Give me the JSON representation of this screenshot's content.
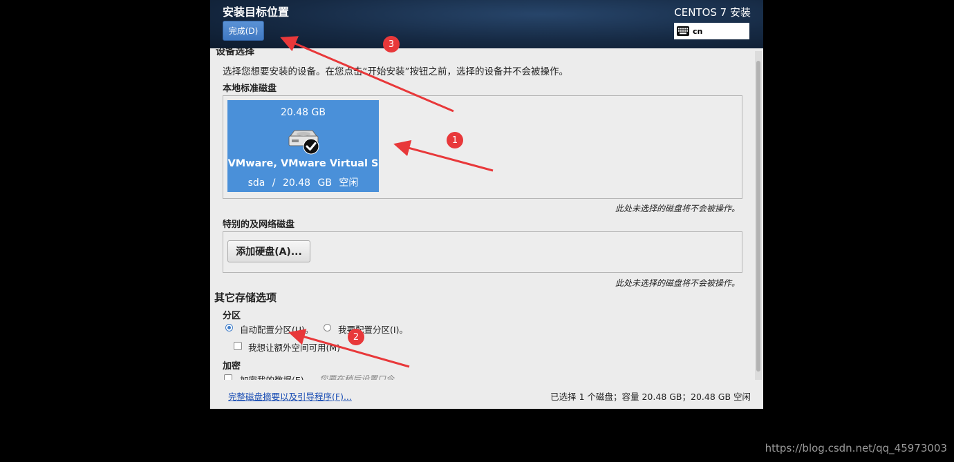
{
  "header": {
    "title": "安装目标位置",
    "done_label": "完成(D)",
    "product": "CENTOS 7 安装",
    "keyboard_layout": "cn"
  },
  "device_selection": {
    "title": "设备选择",
    "description": "选择您想要安装的设备。在您点击“开始安装”按钮之前，选择的设备并不会被操作。",
    "local_label": "本地标准磁盘",
    "disk": {
      "size": "20.48 GB",
      "name": "VMware, VMware Virtual S",
      "device": "sda",
      "separator": "/",
      "free": "20.48 GB 空闲",
      "selected": true
    },
    "unselected_note": "此处未选择的磁盘将不会被操作。",
    "special_label": "特别的及网络磁盘",
    "add_disk_label": "添加硬盘(A)...",
    "special_note": "此处未选择的磁盘将不会被操作。"
  },
  "other_storage": {
    "title": "其它存储选项",
    "partition_label": "分区",
    "auto_partition": "自动配置分区(U)。",
    "manual_partition": "我要配置分区(I)。",
    "extra_space": "我想让额外空间可用(M)",
    "encrypt_label": "加密",
    "encrypt_data": "加密我的数据(E)",
    "encrypt_hint": "您要在稍后设置口令"
  },
  "footer": {
    "summary_link": "完整磁盘摘要以及引导程序(F)...",
    "selection_summary": "已选择 1 个磁盘；容量 20.48 GB；20.48 GB 空闲"
  },
  "annotations": [
    "1",
    "2",
    "3"
  ],
  "watermark": "https://blog.csdn.net/qq_45973003",
  "colors": {
    "accent": "#4a90d9",
    "annotation": "#e8383a",
    "header_bg": "#162a44"
  }
}
